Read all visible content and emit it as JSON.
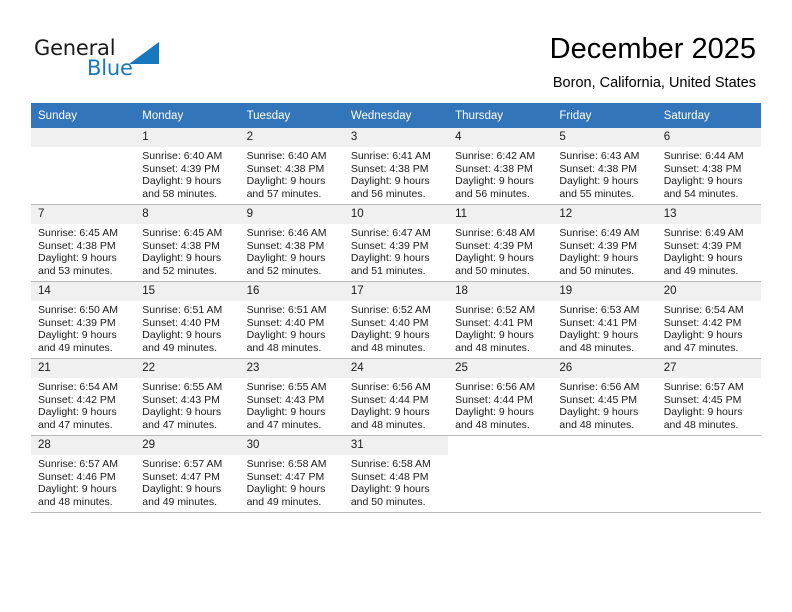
{
  "brand": {
    "general": "General",
    "blue": "Blue",
    "triangle_color": "#1878be"
  },
  "header": {
    "title": "December 2025",
    "subtitle": "Boron, California, United States",
    "header_bg": "#3275bb",
    "daynum_bg": "#f0f0f0"
  },
  "weekdays": [
    "Sunday",
    "Monday",
    "Tuesday",
    "Wednesday",
    "Thursday",
    "Friday",
    "Saturday"
  ],
  "labels": {
    "sunrise_prefix": "Sunrise: ",
    "sunset_prefix": "Sunset: ",
    "daylight_prefix": "Daylight: "
  },
  "weeks": [
    [
      {
        "day": "",
        "lines": []
      },
      {
        "day": "1",
        "lines": [
          "Sunrise: 6:40 AM",
          "Sunset: 4:39 PM",
          "Daylight: 9 hours",
          "and 58 minutes."
        ]
      },
      {
        "day": "2",
        "lines": [
          "Sunrise: 6:40 AM",
          "Sunset: 4:38 PM",
          "Daylight: 9 hours",
          "and 57 minutes."
        ]
      },
      {
        "day": "3",
        "lines": [
          "Sunrise: 6:41 AM",
          "Sunset: 4:38 PM",
          "Daylight: 9 hours",
          "and 56 minutes."
        ]
      },
      {
        "day": "4",
        "lines": [
          "Sunrise: 6:42 AM",
          "Sunset: 4:38 PM",
          "Daylight: 9 hours",
          "and 56 minutes."
        ]
      },
      {
        "day": "5",
        "lines": [
          "Sunrise: 6:43 AM",
          "Sunset: 4:38 PM",
          "Daylight: 9 hours",
          "and 55 minutes."
        ]
      },
      {
        "day": "6",
        "lines": [
          "Sunrise: 6:44 AM",
          "Sunset: 4:38 PM",
          "Daylight: 9 hours",
          "and 54 minutes."
        ]
      }
    ],
    [
      {
        "day": "7",
        "lines": [
          "Sunrise: 6:45 AM",
          "Sunset: 4:38 PM",
          "Daylight: 9 hours",
          "and 53 minutes."
        ]
      },
      {
        "day": "8",
        "lines": [
          "Sunrise: 6:45 AM",
          "Sunset: 4:38 PM",
          "Daylight: 9 hours",
          "and 52 minutes."
        ]
      },
      {
        "day": "9",
        "lines": [
          "Sunrise: 6:46 AM",
          "Sunset: 4:38 PM",
          "Daylight: 9 hours",
          "and 52 minutes."
        ]
      },
      {
        "day": "10",
        "lines": [
          "Sunrise: 6:47 AM",
          "Sunset: 4:39 PM",
          "Daylight: 9 hours",
          "and 51 minutes."
        ]
      },
      {
        "day": "11",
        "lines": [
          "Sunrise: 6:48 AM",
          "Sunset: 4:39 PM",
          "Daylight: 9 hours",
          "and 50 minutes."
        ]
      },
      {
        "day": "12",
        "lines": [
          "Sunrise: 6:49 AM",
          "Sunset: 4:39 PM",
          "Daylight: 9 hours",
          "and 50 minutes."
        ]
      },
      {
        "day": "13",
        "lines": [
          "Sunrise: 6:49 AM",
          "Sunset: 4:39 PM",
          "Daylight: 9 hours",
          "and 49 minutes."
        ]
      }
    ],
    [
      {
        "day": "14",
        "lines": [
          "Sunrise: 6:50 AM",
          "Sunset: 4:39 PM",
          "Daylight: 9 hours",
          "and 49 minutes."
        ]
      },
      {
        "day": "15",
        "lines": [
          "Sunrise: 6:51 AM",
          "Sunset: 4:40 PM",
          "Daylight: 9 hours",
          "and 49 minutes."
        ]
      },
      {
        "day": "16",
        "lines": [
          "Sunrise: 6:51 AM",
          "Sunset: 4:40 PM",
          "Daylight: 9 hours",
          "and 48 minutes."
        ]
      },
      {
        "day": "17",
        "lines": [
          "Sunrise: 6:52 AM",
          "Sunset: 4:40 PM",
          "Daylight: 9 hours",
          "and 48 minutes."
        ]
      },
      {
        "day": "18",
        "lines": [
          "Sunrise: 6:52 AM",
          "Sunset: 4:41 PM",
          "Daylight: 9 hours",
          "and 48 minutes."
        ]
      },
      {
        "day": "19",
        "lines": [
          "Sunrise: 6:53 AM",
          "Sunset: 4:41 PM",
          "Daylight: 9 hours",
          "and 48 minutes."
        ]
      },
      {
        "day": "20",
        "lines": [
          "Sunrise: 6:54 AM",
          "Sunset: 4:42 PM",
          "Daylight: 9 hours",
          "and 47 minutes."
        ]
      }
    ],
    [
      {
        "day": "21",
        "lines": [
          "Sunrise: 6:54 AM",
          "Sunset: 4:42 PM",
          "Daylight: 9 hours",
          "and 47 minutes."
        ]
      },
      {
        "day": "22",
        "lines": [
          "Sunrise: 6:55 AM",
          "Sunset: 4:43 PM",
          "Daylight: 9 hours",
          "and 47 minutes."
        ]
      },
      {
        "day": "23",
        "lines": [
          "Sunrise: 6:55 AM",
          "Sunset: 4:43 PM",
          "Daylight: 9 hours",
          "and 47 minutes."
        ]
      },
      {
        "day": "24",
        "lines": [
          "Sunrise: 6:56 AM",
          "Sunset: 4:44 PM",
          "Daylight: 9 hours",
          "and 48 minutes."
        ]
      },
      {
        "day": "25",
        "lines": [
          "Sunrise: 6:56 AM",
          "Sunset: 4:44 PM",
          "Daylight: 9 hours",
          "and 48 minutes."
        ]
      },
      {
        "day": "26",
        "lines": [
          "Sunrise: 6:56 AM",
          "Sunset: 4:45 PM",
          "Daylight: 9 hours",
          "and 48 minutes."
        ]
      },
      {
        "day": "27",
        "lines": [
          "Sunrise: 6:57 AM",
          "Sunset: 4:45 PM",
          "Daylight: 9 hours",
          "and 48 minutes."
        ]
      }
    ],
    [
      {
        "day": "28",
        "lines": [
          "Sunrise: 6:57 AM",
          "Sunset: 4:46 PM",
          "Daylight: 9 hours",
          "and 48 minutes."
        ]
      },
      {
        "day": "29",
        "lines": [
          "Sunrise: 6:57 AM",
          "Sunset: 4:47 PM",
          "Daylight: 9 hours",
          "and 49 minutes."
        ]
      },
      {
        "day": "30",
        "lines": [
          "Sunrise: 6:58 AM",
          "Sunset: 4:47 PM",
          "Daylight: 9 hours",
          "and 49 minutes."
        ]
      },
      {
        "day": "31",
        "lines": [
          "Sunrise: 6:58 AM",
          "Sunset: 4:48 PM",
          "Daylight: 9 hours",
          "and 50 minutes."
        ]
      },
      {
        "day": "",
        "lines": [],
        "blank": true
      },
      {
        "day": "",
        "lines": [],
        "blank": true
      },
      {
        "day": "",
        "lines": [],
        "blank": true
      }
    ]
  ]
}
